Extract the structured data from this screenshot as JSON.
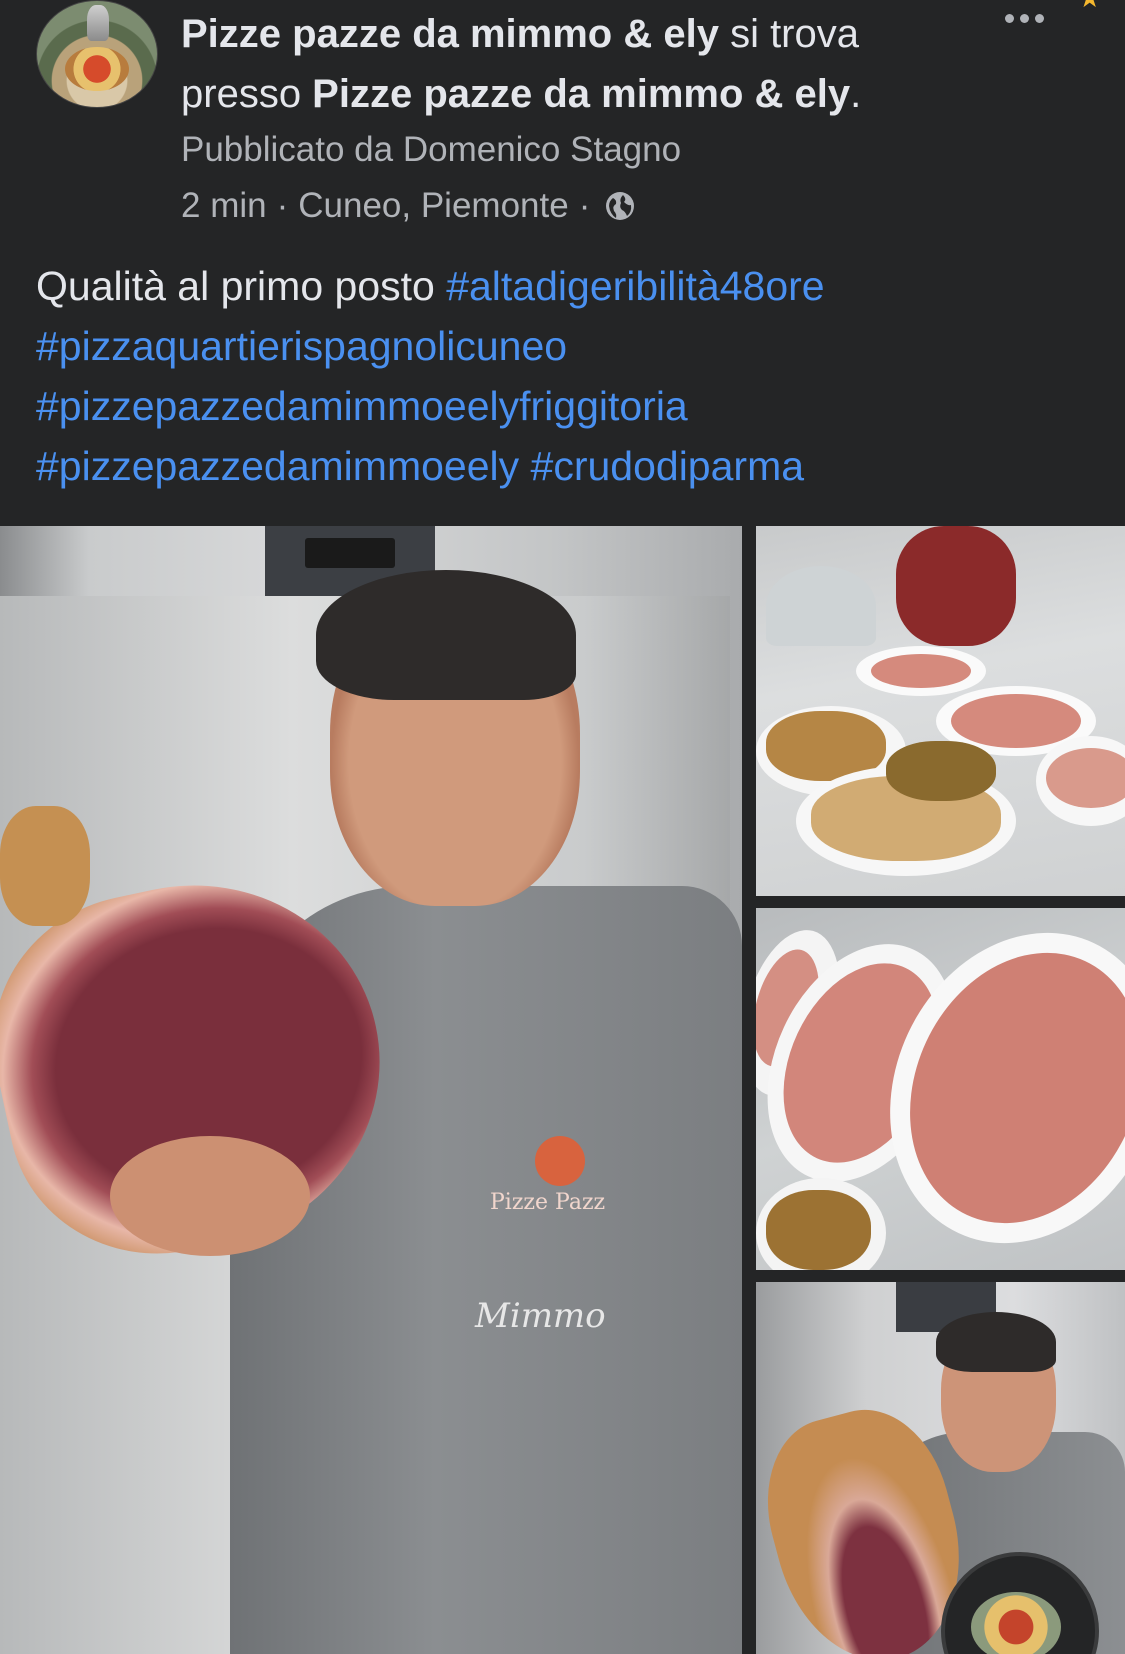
{
  "header": {
    "page_name": "Pizze pazze da mimmo & ely",
    "connector": " si trova presso ",
    "location_name": "Pizze pazze da mimmo & ely",
    "end_punct": ".",
    "published_by": "Pubblicato da Domenico Stagno",
    "time": "2 min",
    "place": "Cuneo, Piemonte",
    "separator": "·"
  },
  "caption": {
    "text": "Qualità al primo posto ",
    "hashtags": [
      "#altadigeribilità48ore",
      "#pizzaquartierispagnolicuneo",
      "#pizzepazzedamimmoeelyfriggitoria",
      "#pizzepazzedamimmoeely",
      "#crudodiparma"
    ]
  },
  "photos": {
    "main_apron_logo": "Pizze Pazz",
    "main_apron_name": "Mimmo"
  },
  "icons": {
    "more": "more-options-icon",
    "privacy": "globe-icon",
    "badge": "star-icon"
  },
  "colors": {
    "background": "#242526",
    "text": "#e4e6eb",
    "secondary_text": "#b0b3b8",
    "hashtag": "#4a90f0"
  }
}
